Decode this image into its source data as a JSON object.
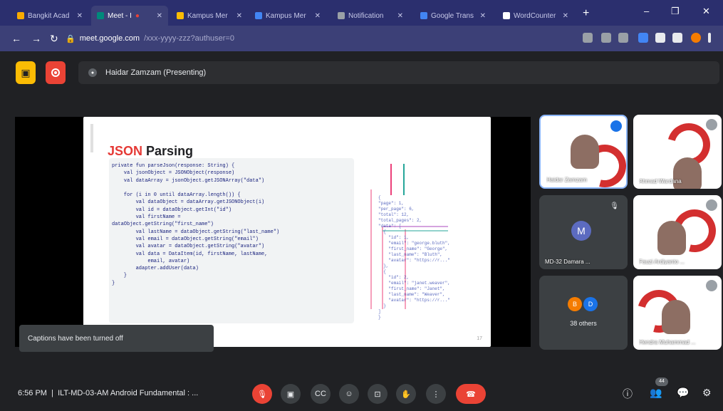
{
  "browser": {
    "tabs": [
      {
        "title": "Bangkit Acad",
        "color": "#f9ab00"
      },
      {
        "title": "Meet - I",
        "color": "#00897b",
        "active": true
      },
      {
        "title": "Kampus Mer",
        "color": "#fbbc04"
      },
      {
        "title": "Kampus Mer",
        "color": "#4285f4"
      },
      {
        "title": "Notification",
        "color": "#9aa0a6"
      },
      {
        "title": "Google Trans",
        "color": "#4285f4"
      },
      {
        "title": "WordCounter",
        "color": "#ffffff"
      }
    ],
    "url_host": "meet.google.com",
    "url_path": "/xxx-yyyy-zzz?authuser=0"
  },
  "meet": {
    "presenter": "Haidar Zamzam (Presenting)",
    "caption_toast": "Captions have been turned off",
    "time": "6:56 PM",
    "meeting_name": "ILT-MD-03-AM Android Fundamental : ...",
    "participants_badge": "44",
    "tiles": [
      {
        "name": "Haidar Zamzam",
        "speaking": true
      },
      {
        "name": "Ahmad Wardana",
        "speaking": false
      },
      {
        "name": "MD-32 Damara ...",
        "avatar_letter": "M"
      },
      {
        "name": "Fauzi Ardiyanto ...",
        "speaking": false
      },
      {
        "name": "38 others",
        "avatar_letters": [
          "B",
          "D"
        ]
      },
      {
        "name": "Hendra Muhammad ...",
        "speaking": false
      }
    ]
  },
  "slide": {
    "title_highlight": "JSON",
    "title_rest": " Parsing",
    "page_number": "17",
    "code": "private fun parseJson(response: String) {\n    val jsonObject = JSONObject(response)\n    val dataArray = jsonObject.getJSONArray(\"data\")\n\n    for (i in 0 until dataArray.length()) {\n        val dataObject = dataArray.getJSONObject(i)\n        val id = dataObject.getInt(\"id\")\n        val firstName =\ndataObject.getString(\"first_name\")\n        val lastName = dataObject.getString(\"last_name\")\n        val email = dataObject.getString(\"email\")\n        val avatar = dataObject.getString(\"avatar\")\n        val data = DataItem(id, firstName, lastName,\n            email, avatar)\n        adapter.addUser(data)\n    }\n}",
    "diagram_text": "{\n\"page\": 1,\n\"per_page\": 6,\n\"total\": 12,\n\"total_pages\": 2,\n\"data\": [\n  {\n    \"id\": 1,\n    \"email\": \"george.bluth\",\n    \"first_name\": \"George\",\n    \"last_name\": \"Bluth\",\n    \"avatar\": \"https://r...\"\n  },\n  {\n    \"id\": 2,\n    \"email\": \"janet.weaver\",\n    \"first_name\": \"Janet\",\n    \"last_name\": \"Weaver\",\n    \"avatar\": \"https://r...\"\n  }\n]\n}"
  },
  "colors": {
    "accent_red": "#ea4335",
    "present_yellow": "#fbbc04",
    "speaking_blue": "#8ab4f8"
  }
}
